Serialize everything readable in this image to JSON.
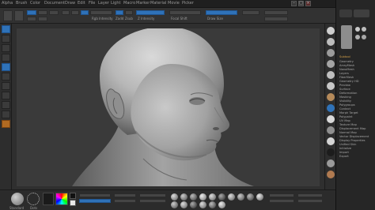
{
  "menus": [
    "Alpha",
    "Brush",
    "Color",
    "Document",
    "Draw",
    "Edit",
    "File",
    "Layer",
    "Light",
    "Macro",
    "Marker",
    "Material",
    "Movie",
    "Picker"
  ],
  "top_labels": {
    "rgb_intensity": "Rgb Intensity",
    "z_intensity": "Z Intensity",
    "draw_size": "Draw Size",
    "focal_shift": "Focal Shift",
    "zadd": "Zadd",
    "zsub": "Zsub"
  },
  "bottom_labels": {
    "standard": "Standard",
    "dots": "Dots",
    "alpha_off": "Alpha Off",
    "texture_off": "Texture Off",
    "material": "MatCap Gray"
  },
  "tray": {
    "header1": "Subtool",
    "rows": [
      "Geometry",
      "ArrayMesh",
      "NanoMesh",
      "Layers",
      "FiberMesh",
      "Geometry HD",
      "Preview",
      "Surface",
      "Deformation",
      "Masking",
      "Visibility",
      "Polygroups",
      "Contact",
      "Morph Target",
      "Polypaint",
      "UV Map",
      "Texture Map",
      "Displacement Map",
      "Normal Map",
      "Vector Displacement",
      "Display Properties",
      "Unified Skin",
      "Initialize",
      "Import",
      "Export"
    ]
  },
  "colors": {
    "accent_blue": "#2f72b8",
    "accent_orange": "#d6a24a",
    "bg": "#2a2a2a"
  }
}
